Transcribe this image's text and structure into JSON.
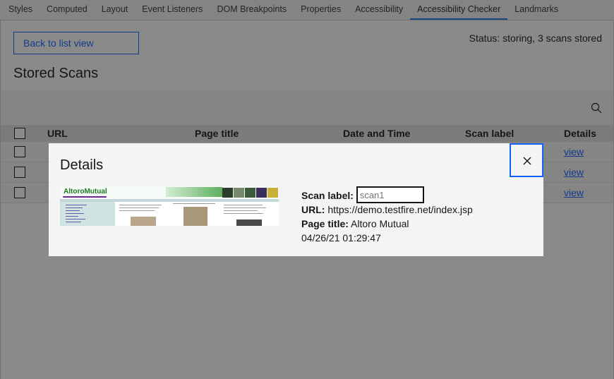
{
  "tabs": [
    "Styles",
    "Computed",
    "Layout",
    "Event Listeners",
    "DOM Breakpoints",
    "Properties",
    "Accessibility",
    "Accessibility Checker",
    "Landmarks"
  ],
  "active_tab": "Accessibility Checker",
  "panel": {
    "back_label": "Back to list view",
    "status": "Status: storing, 3 scans stored",
    "heading": "Stored Scans",
    "search_icon": "search-icon"
  },
  "table": {
    "headers": {
      "url": "URL",
      "page_title": "Page title",
      "date_time": "Date and Time",
      "scan_label": "Scan label",
      "details": "Details"
    },
    "rows": [
      {
        "details_link": "view"
      },
      {
        "details_link": "view"
      },
      {
        "details_link": "view"
      }
    ]
  },
  "modal": {
    "title": "Details",
    "close_icon": "close-icon",
    "thumbnail_brand": "AltoroMutual",
    "scan_label_label": "Scan label:",
    "scan_label_placeholder": "scan1",
    "url_label": "URL:",
    "url_value": "https://demo.testfire.net/index.jsp",
    "page_title_label": "Page title:",
    "page_title_value": "Altoro Mutual",
    "datetime": "04/26/21 01:29:47"
  },
  "colors": {
    "accent": "#0f62fe",
    "overlay": "rgba(22,22,22,0.5)",
    "modal_bg": "#f4f4f4"
  }
}
